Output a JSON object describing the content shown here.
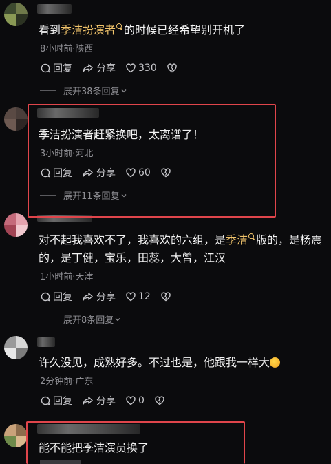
{
  "comments": [
    {
      "text_pre": "看到",
      "text_highlight": "季洁扮演者",
      "text_post": "的时候已经希望别开机了",
      "meta": "8小时前·陕西",
      "reply_label": "回复",
      "share_label": "分享",
      "like_count": "330",
      "expand_label": "展开38条回复"
    },
    {
      "text": "季洁扮演者赶紧换吧，太离谱了！",
      "meta": "3小时前·河北",
      "reply_label": "回复",
      "share_label": "分享",
      "like_count": "60",
      "expand_label": "展开11条回复"
    },
    {
      "text_pre": "对不起我喜欢不了，我喜欢的六组，是",
      "text_highlight": "季洁",
      "text_post": "版的，是杨震",
      "text_line2": "的，是丁健，宝乐，田蕊，大曾，江汉",
      "meta": "1小时前·天津",
      "reply_label": "回复",
      "share_label": "分享",
      "like_count": "12",
      "expand_label": "展开8条回复"
    },
    {
      "text": "许久没见，成熟好多。不过也是，他跟我一样大",
      "meta": "2分钟前·广东",
      "reply_label": "回复",
      "share_label": "分享",
      "like_count": "0"
    },
    {
      "text": "能不能把季洁演员换了"
    }
  ],
  "colors": {
    "background": "#0b0b0d",
    "keyword_highlight": "#f0c36b",
    "annotation_box": "#e0454b",
    "meta_text": "#8e8e93"
  },
  "icons": {
    "reply": "reply-bubble-icon",
    "share": "share-arrow-icon",
    "like": "heart-icon",
    "dislike": "broken-heart-icon",
    "search_keyword": "search-icon",
    "emoji": "laughing-emoji-icon",
    "expand": "chevron-down-icon"
  }
}
